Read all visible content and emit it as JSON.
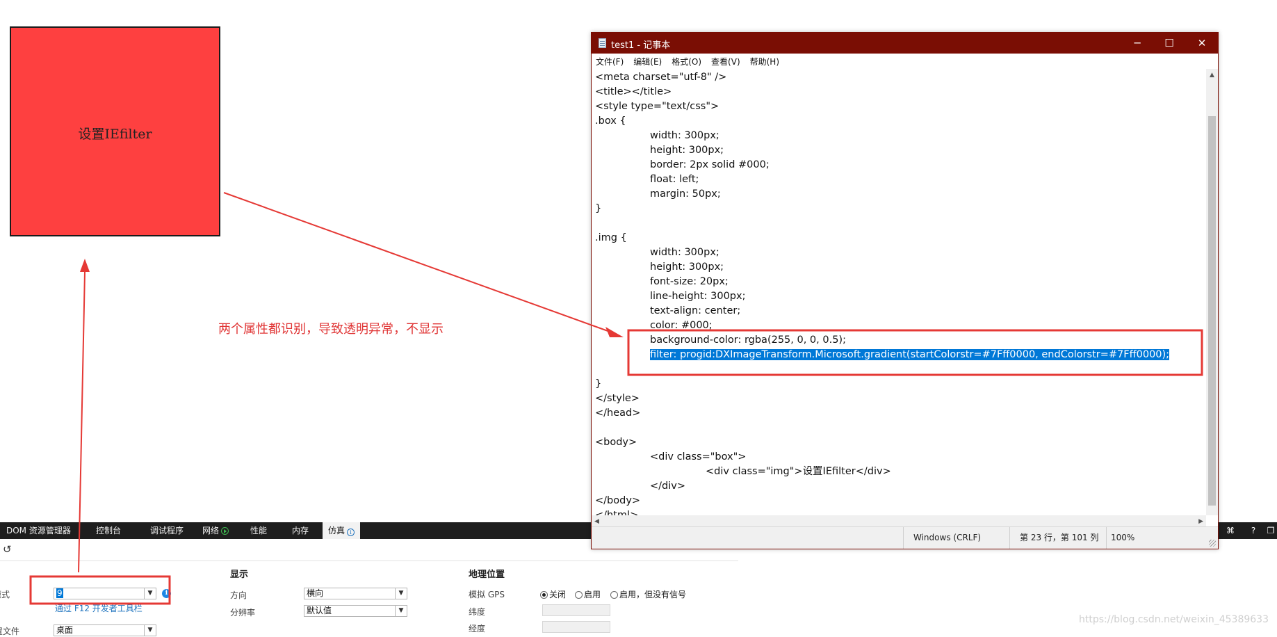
{
  "page": {
    "box_text": "设置IEfilter",
    "annotation": "两个属性都识别，导致透明异常，不显示"
  },
  "notepad": {
    "title": "test1 - 记事本",
    "controls": {
      "minimize": "─",
      "maximize": "☐",
      "close": "✕"
    },
    "menu": [
      "文件(F)",
      "编辑(E)",
      "格式(O)",
      "查看(V)",
      "帮助(H)"
    ],
    "lines": [
      "<meta charset=\"utf-8\" />",
      "<title></title>",
      "<style type=\"text/css\">",
      ".box {",
      "width: 300px;",
      "height: 300px;",
      "border: 2px solid #000;",
      "float: left;",
      "margin: 50px;",
      "}",
      "",
      ".img {",
      "width: 300px;",
      "height: 300px;",
      "font-size: 20px;",
      "line-height: 300px;",
      "text-align: center;",
      "color: #000;",
      "background-color: rgba(255, 0, 0, 0.5);",
      "filter: progid:DXImageTransform.Microsoft.gradient(startColorstr=#7Fff0000, endColorstr=#7Fff0000);",
      "",
      "}",
      "</style>",
      "</head>",
      "",
      "<body>",
      "<div class=\"box\">",
      "<div class=\"img\">设置IEfilter</div>",
      "</div>",
      "</body>",
      "</html>"
    ],
    "status": {
      "eol": "Windows (CRLF)",
      "position": "第 23 行，第 101 列",
      "zoom": "100%"
    }
  },
  "devtools": {
    "tabs": [
      "DOM 资源管理器",
      "控制台",
      "调试程序",
      "网络",
      "性能",
      "内存",
      "仿真"
    ],
    "active_tab": "仿真",
    "mode_label": "模式",
    "mode_value": "9",
    "mode_hint": "通过 F12 开发者工具栏",
    "profile_label": "配置文件",
    "profile_value": "桌面",
    "display": {
      "heading": "显示",
      "orientation_label": "方向",
      "orientation_value": "横向",
      "resolution_label": "分辨率",
      "resolution_value": "默认值"
    },
    "geo": {
      "heading": "地理位置",
      "gps_label": "模拟 GPS",
      "options": [
        "关闭",
        "启用",
        "启用，但没有信号"
      ],
      "latitude_label": "纬度",
      "longitude_label": "经度"
    }
  },
  "watermark": "https://blog.csdn.net/weixin_45389633",
  "colors": {
    "box_fill": "#fe4040",
    "annotation": "#e03535",
    "notepad_titlebar": "#7a0e04",
    "selection": "#0078d7"
  }
}
